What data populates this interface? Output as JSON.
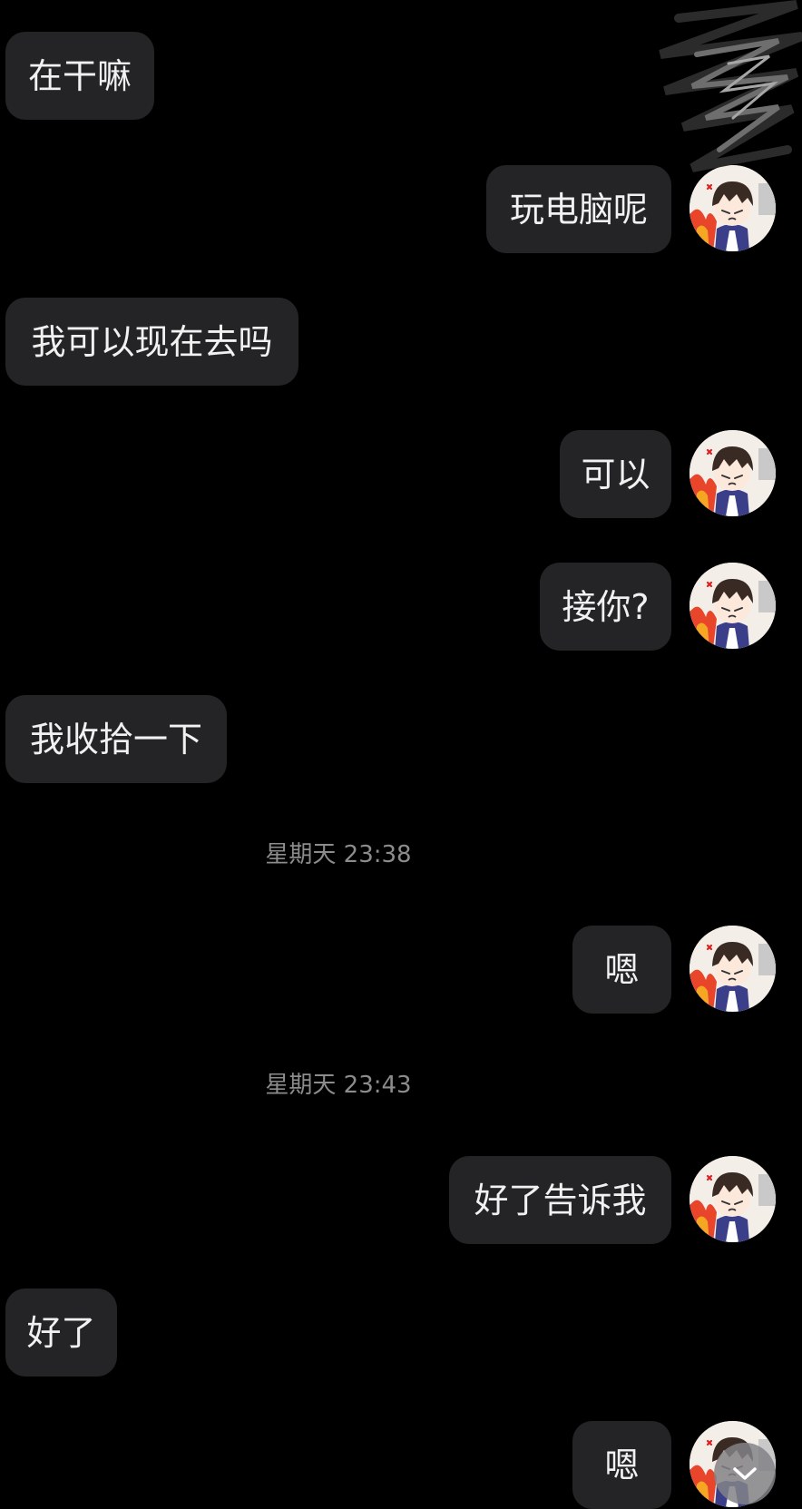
{
  "messages": [
    {
      "side": "left",
      "text": "在干嘛"
    },
    {
      "side": "right",
      "text": "玩电脑呢"
    },
    {
      "side": "left",
      "text": "我可以现在去吗"
    },
    {
      "side": "right",
      "text": "可以"
    },
    {
      "side": "right",
      "text": "接你?"
    },
    {
      "side": "left",
      "text": "我收拾一下"
    },
    {
      "type": "timestamp",
      "text": "星期天 23:38"
    },
    {
      "side": "right",
      "text": "嗯"
    },
    {
      "type": "timestamp",
      "text": "星期天 23:43"
    },
    {
      "side": "right",
      "text": "好了告诉我"
    },
    {
      "side": "left",
      "text": "好了"
    },
    {
      "side": "right",
      "text": "嗯"
    }
  ],
  "icons": {
    "avatar": "anime-avatar-icon",
    "scroll_button": "chevron-down-icon",
    "redaction": "scribble-redaction"
  },
  "colors": {
    "background": "#000000",
    "bubble": "#242426",
    "text": "#f1f1f1",
    "timestamp": "#8c8c8c"
  }
}
